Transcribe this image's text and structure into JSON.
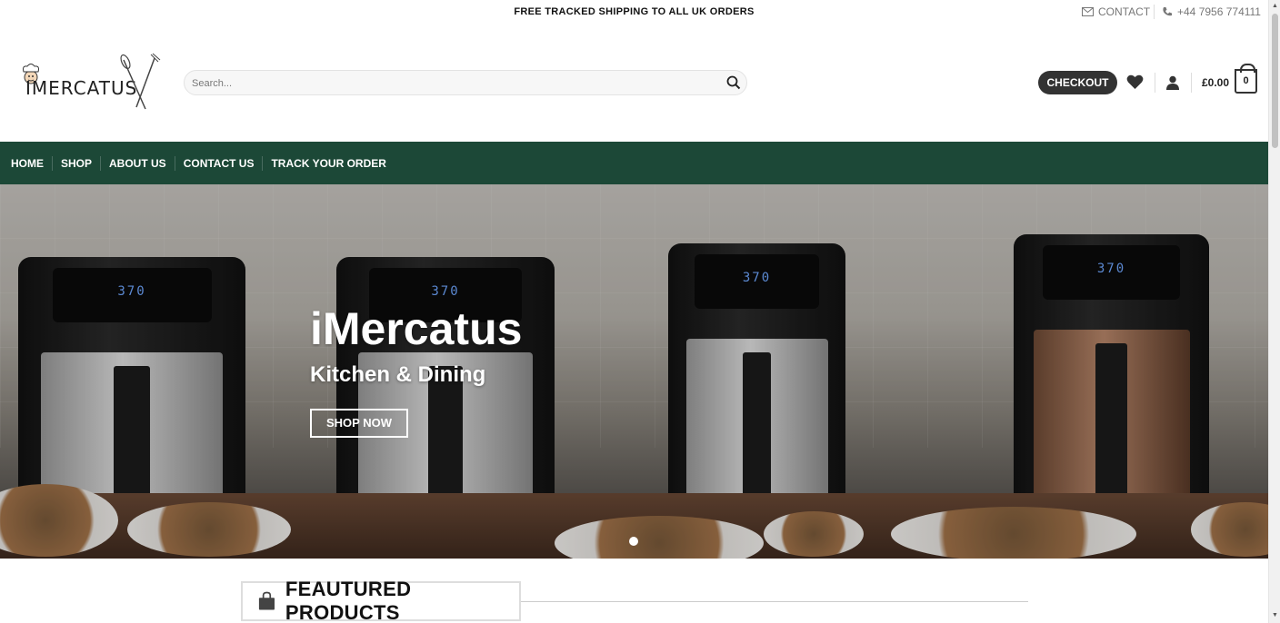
{
  "topbar": {
    "shipping": "FREE TRACKED SHIPPING TO ALL UK ORDERS",
    "contact_label": "CONTACT",
    "phone": "+44 7956 774111"
  },
  "header": {
    "logo_text": "IMERCATUS",
    "search_placeholder": "Search...",
    "checkout_label": "CHECKOUT",
    "cart_total": "£0.00",
    "cart_count": "0"
  },
  "nav": {
    "items": [
      {
        "label": "HOME"
      },
      {
        "label": "SHOP"
      },
      {
        "label": "ABOUT US"
      },
      {
        "label": "CONTACT US"
      },
      {
        "label": "TRACK YOUR ORDER"
      }
    ]
  },
  "hero": {
    "title": "iMercatus",
    "subtitle": "Kitchen & Dining",
    "button_label": "SHOP NOW",
    "fryer_display": "370"
  },
  "featured": {
    "heading": "FEAUTURED PRODUCTS"
  },
  "colors": {
    "nav_bg": "#1c4837",
    "checkout_bg": "#333333"
  }
}
